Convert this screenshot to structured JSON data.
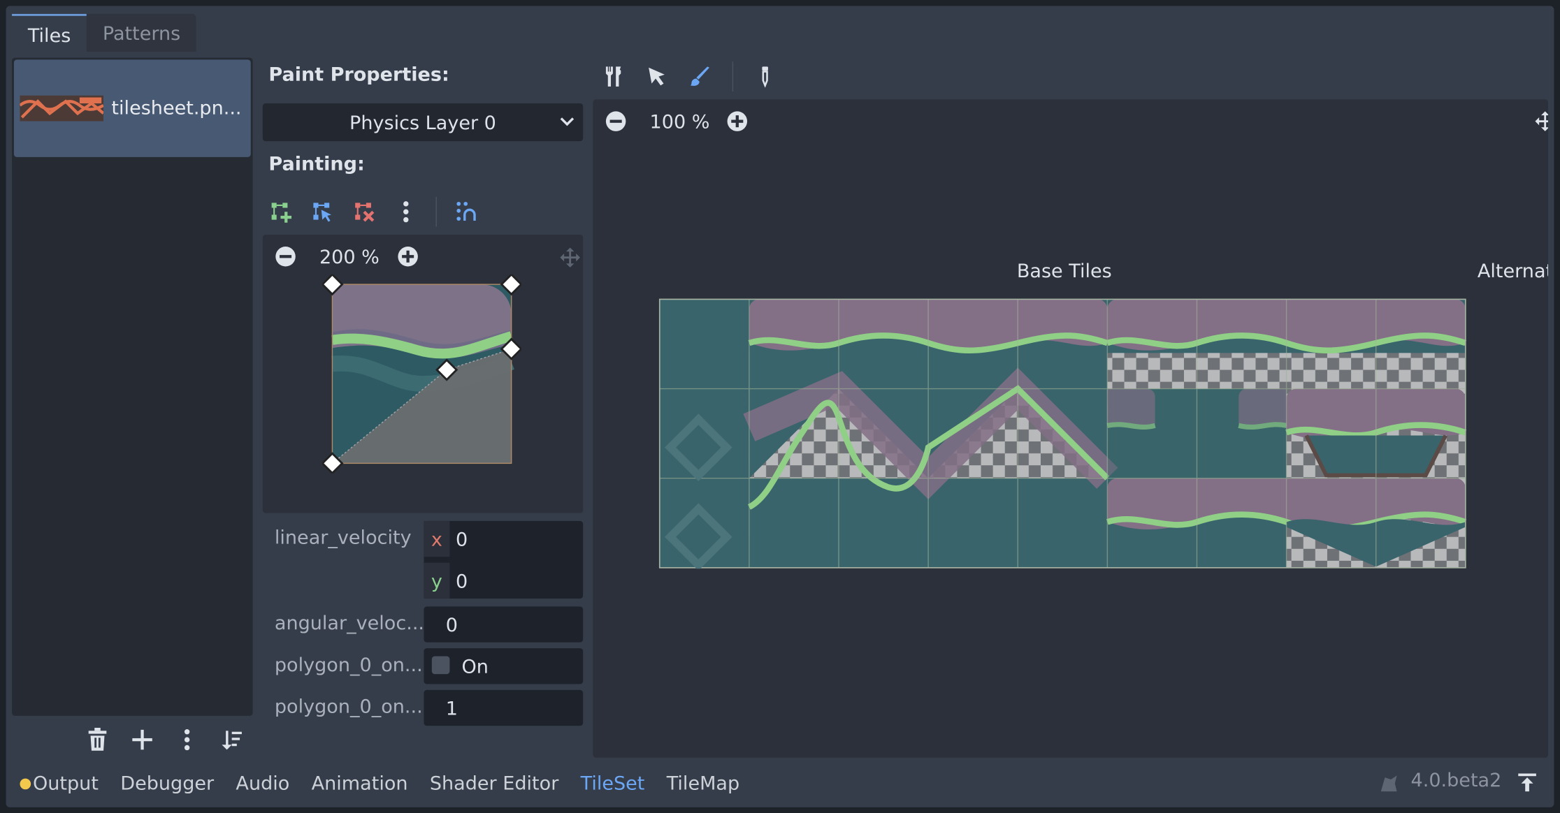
{
  "tabs": [
    {
      "label": "Tiles",
      "active": true
    },
    {
      "label": "Patterns",
      "active": false
    }
  ],
  "sources": [
    {
      "label": "tilesheet.pn..."
    }
  ],
  "paint_properties_label": "Paint Properties:",
  "layer_dropdown": {
    "value": "Physics Layer 0"
  },
  "painting_label": "Painting:",
  "preview_zoom": "200 %",
  "atlas_zoom": "100 %",
  "atlas_sections": {
    "base": "Base Tiles",
    "alternative": "Alternat"
  },
  "properties": [
    {
      "name": "linear_velocity",
      "x_label": "x",
      "x": "0",
      "y_label": "y",
      "y": "0"
    },
    {
      "name": "angular_veloc...",
      "value": "0"
    },
    {
      "name": "polygon_0_on...",
      "value": "On",
      "checked": false
    },
    {
      "name": "polygon_0_on...",
      "value": "1"
    }
  ],
  "bottom_tabs": [
    {
      "label": "Output",
      "active": false,
      "dot": true
    },
    {
      "label": "Debugger",
      "active": false
    },
    {
      "label": "Audio",
      "active": false
    },
    {
      "label": "Animation",
      "active": false
    },
    {
      "label": "Shader Editor",
      "active": false
    },
    {
      "label": "TileSet",
      "active": true
    },
    {
      "label": "TileMap",
      "active": false
    }
  ],
  "version": "4.0.beta2",
  "colors": {
    "accent": "#6ba7f5",
    "panel": "#363d4a",
    "output_dot": "#f2c94c"
  }
}
